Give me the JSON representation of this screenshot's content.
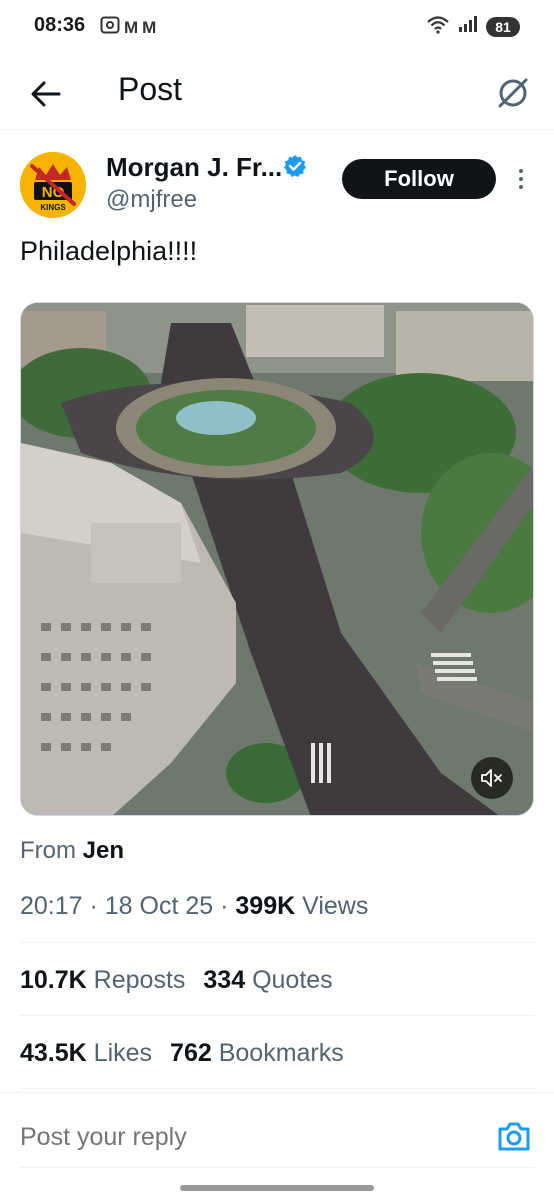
{
  "status_bar": {
    "time": "08:36",
    "left_icons": [
      "screenshot-icon",
      "gmail-icon",
      "gmail-icon"
    ],
    "gmail_glyph": "M",
    "right_icons": [
      "wifi-icon",
      "signal-icon"
    ],
    "battery": "81"
  },
  "header": {
    "title": "Post",
    "back_icon": "back-arrow-icon",
    "grok_icon": "grok-icon"
  },
  "author": {
    "name": "Morgan J. Fr...",
    "handle": "@mjfree",
    "verified": true,
    "avatar_text_top": "NO",
    "avatar_text_bottom": "KINGS",
    "follow_label": "Follow",
    "more_icon": "more-vertical-icon"
  },
  "post": {
    "text": "Philadelphia!!!!",
    "media_type": "video",
    "mute_icon": "muted-speaker-icon"
  },
  "from": {
    "prefix": "From ",
    "name": "Jen"
  },
  "meta": {
    "time": "20:17",
    "date": "18 Oct 25",
    "views_count": "399K",
    "views_label": "Views"
  },
  "stats": {
    "reposts_count": "10.7K",
    "reposts_label": "Reposts",
    "quotes_count": "334",
    "quotes_label": "Quotes",
    "likes_count": "43.5K",
    "likes_label": "Likes",
    "bookmarks_count": "762",
    "bookmarks_label": "Bookmarks"
  },
  "reply": {
    "placeholder": "Post your reply",
    "camera_icon": "camera-icon"
  },
  "colors": {
    "text_primary": "#0f1419",
    "text_secondary": "#536471",
    "verified_blue": "#1d9bf0",
    "follow_bg": "#0f1419",
    "avatar_bg": "#f6b400"
  }
}
